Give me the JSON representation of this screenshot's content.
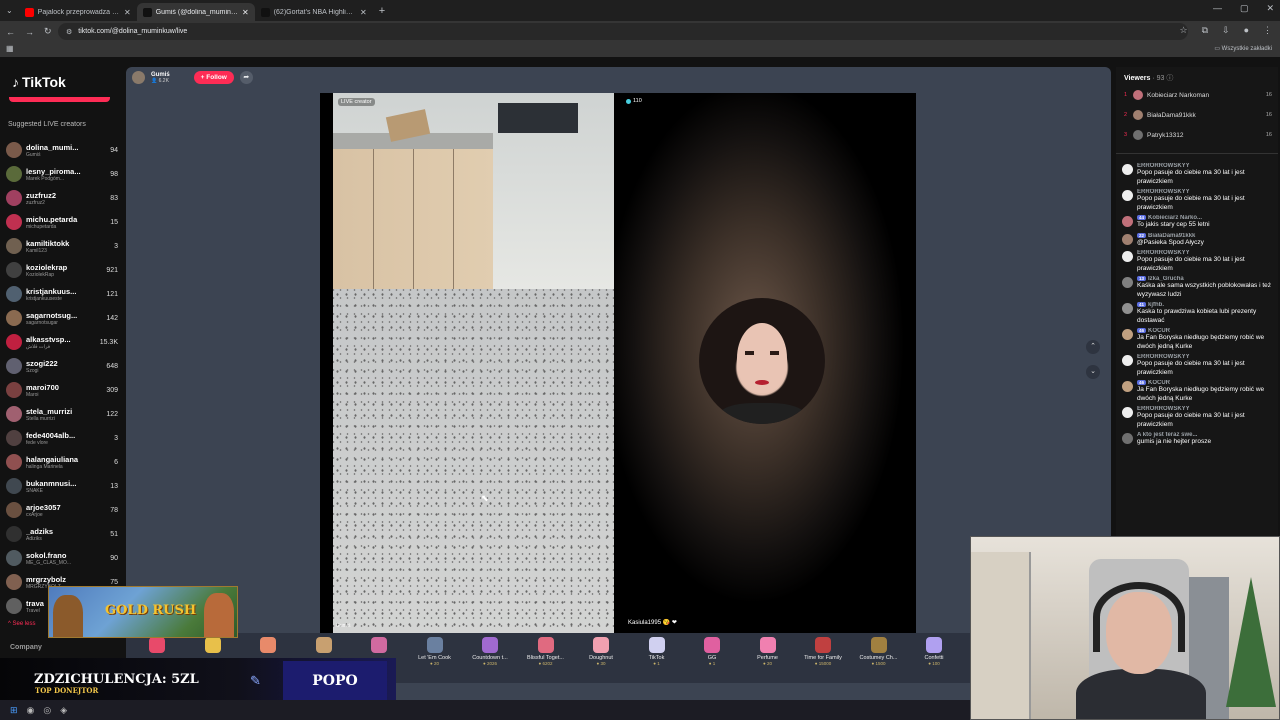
{
  "browser": {
    "tabs": [
      {
        "title": "Pajalock przeprowadza zamach",
        "fav": "#ff0000",
        "active": false
      },
      {
        "title": "Gumiś (@dolina_muminkuw)",
        "fav": "#111111",
        "active": true
      },
      {
        "title": "(62)Gortat's NBA Highlights an",
        "fav": "#111111",
        "active": false
      }
    ],
    "url": "tiktok.com/@dolina_muminkuw/live",
    "bookmarks_label": "Wszystkie zakładki"
  },
  "sidebar": {
    "logo": "TikTok",
    "suggested_title": "Suggested LIVE creators",
    "creators": [
      {
        "name": "dolina_mumi...",
        "sub": "Gumiś",
        "count": "94",
        "color": "#7a5a4a"
      },
      {
        "name": "lesny_piroma...",
        "sub": "Marek Podgóm...",
        "count": "98",
        "color": "#5a6a3a"
      },
      {
        "name": "zuzfruz2",
        "sub": "zuzfruz2",
        "count": "83",
        "color": "#a04060"
      },
      {
        "name": "michu.petarda",
        "sub": "michupetarda",
        "count": "15",
        "color": "#c03050"
      },
      {
        "name": "kamiltiktokk",
        "sub": "Kamil123",
        "count": "3",
        "color": "#706050"
      },
      {
        "name": "koziolekrap",
        "sub": "KoziolekRap",
        "count": "921",
        "color": "#404040"
      },
      {
        "name": "kristjankuus...",
        "sub": "kristjankuuseste",
        "count": "121",
        "color": "#506070"
      },
      {
        "name": "sagarnotsug...",
        "sub": "sagarnotsugar",
        "count": "142",
        "color": "#8a6a50"
      },
      {
        "name": "alkasstvsp...",
        "sub": "فرات قلاش",
        "count": "15.3K",
        "color": "#c02040"
      },
      {
        "name": "szogi222",
        "sub": "Szogi",
        "count": "648",
        "color": "#606070"
      },
      {
        "name": "maroi700",
        "sub": "Maroi",
        "count": "309",
        "color": "#7a4040"
      },
      {
        "name": "stela_murrizi",
        "sub": "Stella murrizi",
        "count": "122",
        "color": "#a06070"
      },
      {
        "name": "fede4004alb...",
        "sub": "fede vlore",
        "count": "3",
        "color": "#504040"
      },
      {
        "name": "halangaiuliana",
        "sub": "halinga Marinela",
        "count": "6",
        "color": "#905050"
      },
      {
        "name": "bukanmnusi...",
        "sub": "SNAKE",
        "count": "13",
        "color": "#404850"
      },
      {
        "name": "arjoe3057",
        "sub": "cxArjoe",
        "count": "78",
        "color": "#6a5040"
      },
      {
        "name": "_adziks",
        "sub": "Adiziks",
        "count": "51",
        "color": "#303030"
      },
      {
        "name": "sokol.frano",
        "sub": "ME_G_CLAS_MO...",
        "count": "90",
        "color": "#505a60"
      },
      {
        "name": "mrgrzybolz",
        "sub": "MRGRZYBOLZ",
        "count": "75",
        "color": "#806050"
      },
      {
        "name": "trava",
        "sub": "Travel",
        "count": "",
        "color": "#606060"
      }
    ],
    "see_less": "See less",
    "company": "Company"
  },
  "stream": {
    "host_name": "Gumiś",
    "host_viewers": "6.2K",
    "follow_label": "+ Follow",
    "live_label": "LIVE creator",
    "viewers_small": "110",
    "left_name": "Gumiś",
    "right_name": "Kasiula1995"
  },
  "gifts": [
    {
      "name": "",
      "coins": "",
      "color": "#e84a6a"
    },
    {
      "name": "",
      "coins": "",
      "color": "#e8c04a"
    },
    {
      "name": "",
      "coins": "",
      "color": "#e88a6a"
    },
    {
      "name": "",
      "coins": "",
      "color": "#c8a070"
    },
    {
      "name": "",
      "coins": "",
      "color": "#d06aa0"
    },
    {
      "name": "Let 'Em Cook",
      "coins": "20",
      "color": "#6a80a0"
    },
    {
      "name": "Countdown t...",
      "coins": "2026",
      "color": "#a06ad0"
    },
    {
      "name": "Blissful Toget...",
      "coins": "6202",
      "color": "#e06a80"
    },
    {
      "name": "Doughnut",
      "coins": "30",
      "color": "#f0a0b0"
    },
    {
      "name": "TikTok",
      "coins": "1",
      "color": "#d0d0f0"
    },
    {
      "name": "GG",
      "coins": "1",
      "color": "#e060a0"
    },
    {
      "name": "Perfume",
      "coins": "20",
      "color": "#f080b0"
    },
    {
      "name": "Time for Family",
      "coins": "15000",
      "color": "#c04040"
    },
    {
      "name": "Costumey Ch...",
      "coins": "1500",
      "color": "#a08040"
    },
    {
      "name": "Confetti",
      "coins": "100",
      "color": "#b0a0f0"
    }
  ],
  "viewers_panel": {
    "title": "Viewers",
    "count": "93",
    "top": [
      {
        "rank": "1",
        "name": "Kobieciarz Narkoman",
        "score": "16",
        "color": "#c0707a"
      },
      {
        "rank": "2",
        "name": "BiałaDama91kkk",
        "score": "16",
        "color": "#a08070"
      },
      {
        "rank": "3",
        "name": "Patryk13312",
        "score": "16",
        "color": "#707070"
      }
    ]
  },
  "chat": [
    {
      "user": "ERRORROWSKYY",
      "text": "Popo pasuje do ciebie ma 30 lat i jest prawiczkiem",
      "color": "#eeeeee"
    },
    {
      "user": "ERRORROWSKYY",
      "text": "Popo pasuje do ciebie ma 30 lat i jest prawiczkiem",
      "color": "#eeeeee"
    },
    {
      "user": "Kobieciarz Narko...",
      "badge": "44",
      "text": "To jakis stary cep 55 letni",
      "color": "#c0707a"
    },
    {
      "user": "BiałaDama91kkk",
      "badge": "22",
      "text": "@Pasieka Spod Ałyczy",
      "color": "#a08070"
    },
    {
      "user": "ERRORROWSKYY",
      "text": "Popo pasuje do ciebie ma 30 lat i jest prawiczkiem",
      "color": "#eeeeee"
    },
    {
      "user": "Izka_Grucha",
      "badge": "13",
      "text": "Kaśka ale sama wszystkich poblokowałas i też wyzywasz ludzi",
      "color": "#808080"
    },
    {
      "user": "kjfhb.",
      "badge": "41",
      "text": "Kaska to prawdziwa kobieta lubi prezenty dostawać",
      "color": "#909090"
    },
    {
      "user": "KOCUR",
      "badge": "46",
      "text": "Ja Fan Boryska niedługo będziemy robić we dwóch jedną Kurke",
      "color": "#c0a080"
    },
    {
      "user": "ERRORROWSKYY",
      "text": "Popo pasuje do ciebie ma 30 lat i jest prawiczkiem",
      "color": "#eeeeee"
    },
    {
      "user": "KOCUR",
      "badge": "46",
      "text": "Ja Fan Boryska niedługo będziemy robić we dwóch jedną Kurke",
      "color": "#c0a080"
    },
    {
      "user": "ERRORROWSKYY",
      "text": "Popo pasuje do ciebie ma 30 lat i jest prawiczkiem",
      "color": "#eeeeee"
    },
    {
      "user": "A kto jest teraz swe...",
      "text": "gumis ja nie hejter prosze",
      "color": "#707070"
    }
  ],
  "overlay": {
    "game_banner": "GOLD RUSH",
    "donation_title": "ZDZICHULENCJA: 5ZL",
    "donation_sub": "TOP DONEJTOR",
    "donation_name": "POPO"
  }
}
